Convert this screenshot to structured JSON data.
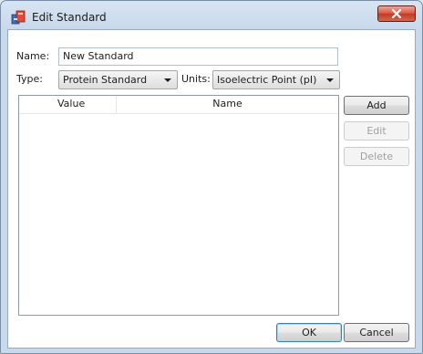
{
  "window": {
    "title": "Edit Standard"
  },
  "form": {
    "name_label": "Name:",
    "name_value": "New Standard",
    "type_label": "Type:",
    "type_value": "Protein Standard",
    "units_label": "Units:",
    "units_value": "Isoelectric Point (pI)"
  },
  "list": {
    "columns": [
      "Value",
      "Name"
    ],
    "rows": []
  },
  "buttons": {
    "add": "Add",
    "edit": "Edit",
    "delete": "Delete",
    "ok": "OK",
    "cancel": "Cancel"
  },
  "colors": {
    "close_button": "#c94a32",
    "accent": "#3c7fb1"
  },
  "icons": {
    "app": "standard-app-icon",
    "close": "close-x-icon",
    "dropdown": "chevron-down-icon"
  }
}
